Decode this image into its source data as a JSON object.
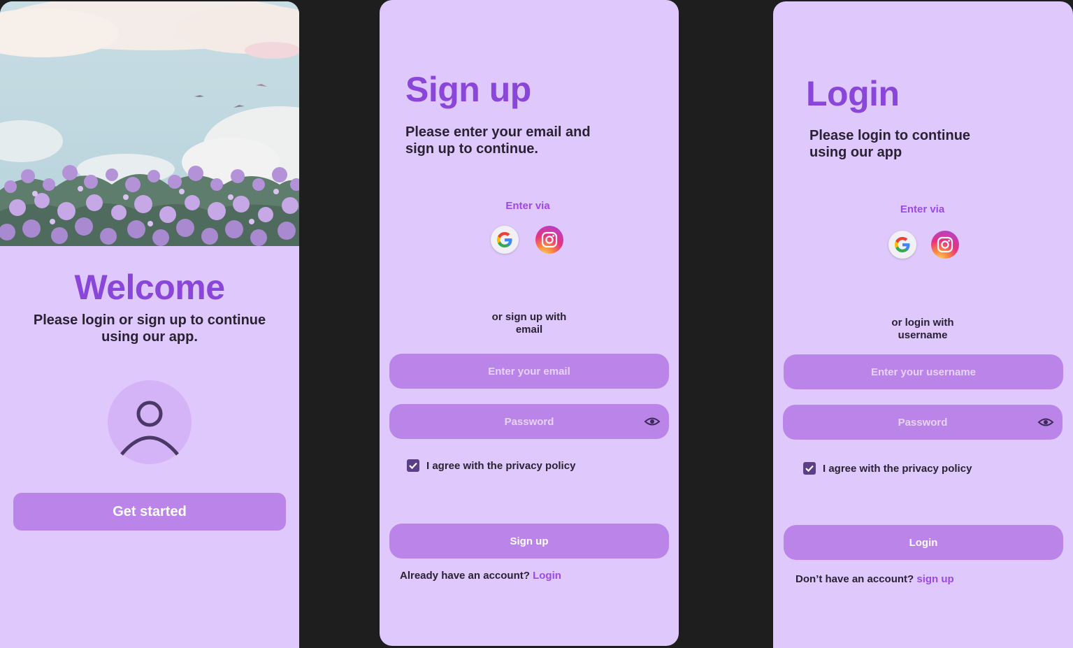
{
  "welcome": {
    "title": "Welcome",
    "subtitle_line1": "Please login or sign up to continue",
    "subtitle_line2": "using our app.",
    "avatar_icon": "user-icon",
    "get_started_label": "Get started"
  },
  "signup": {
    "title": "Sign up",
    "subtitle_line1": "Please enter your email and",
    "subtitle_line2": "sign up to continue.",
    "enter_via": "Enter via",
    "social_icons": [
      "google-icon",
      "instagram-icon"
    ],
    "or_line1": "or sign up with",
    "or_line2": "email",
    "email_placeholder": "Enter your email",
    "password_placeholder": "Password",
    "agree_label": "I agree with the privacy policy",
    "agree_checked": true,
    "submit_label": "Sign up",
    "footer_text": "Already have an account?",
    "footer_link": "Login"
  },
  "login": {
    "title": "Login",
    "subtitle_line1": "Please login to continue",
    "subtitle_line2": "using our app",
    "enter_via": "Enter via",
    "social_icons": [
      "google-icon",
      "instagram-icon"
    ],
    "or_line1": "or login with",
    "or_line2": "username",
    "username_placeholder": "Enter your username",
    "password_placeholder": "Password",
    "agree_label": "I agree with the privacy policy",
    "agree_checked": true,
    "submit_label": "Login",
    "footer_text": "Don’t have an account?",
    "footer_link": "sign up"
  },
  "colors": {
    "background": "#1e1e1e",
    "screen": "#dfc8fc",
    "accent": "#8a45d9",
    "button": "#bb84e8",
    "text": "#2a2233"
  }
}
